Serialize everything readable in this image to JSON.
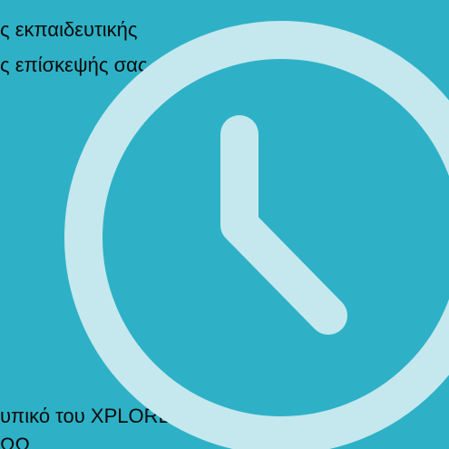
{
  "content": {
    "line1": "ς εκπαιδευτικής",
    "line2": "ς επίσκεψής σας.",
    "line3": "υπικό  του XPLORE,",
    "line4": "ΩΩ"
  },
  "clock": {
    "icon": "clock-icon",
    "color": "#c4e8ee",
    "background": "#2eb1c6"
  }
}
